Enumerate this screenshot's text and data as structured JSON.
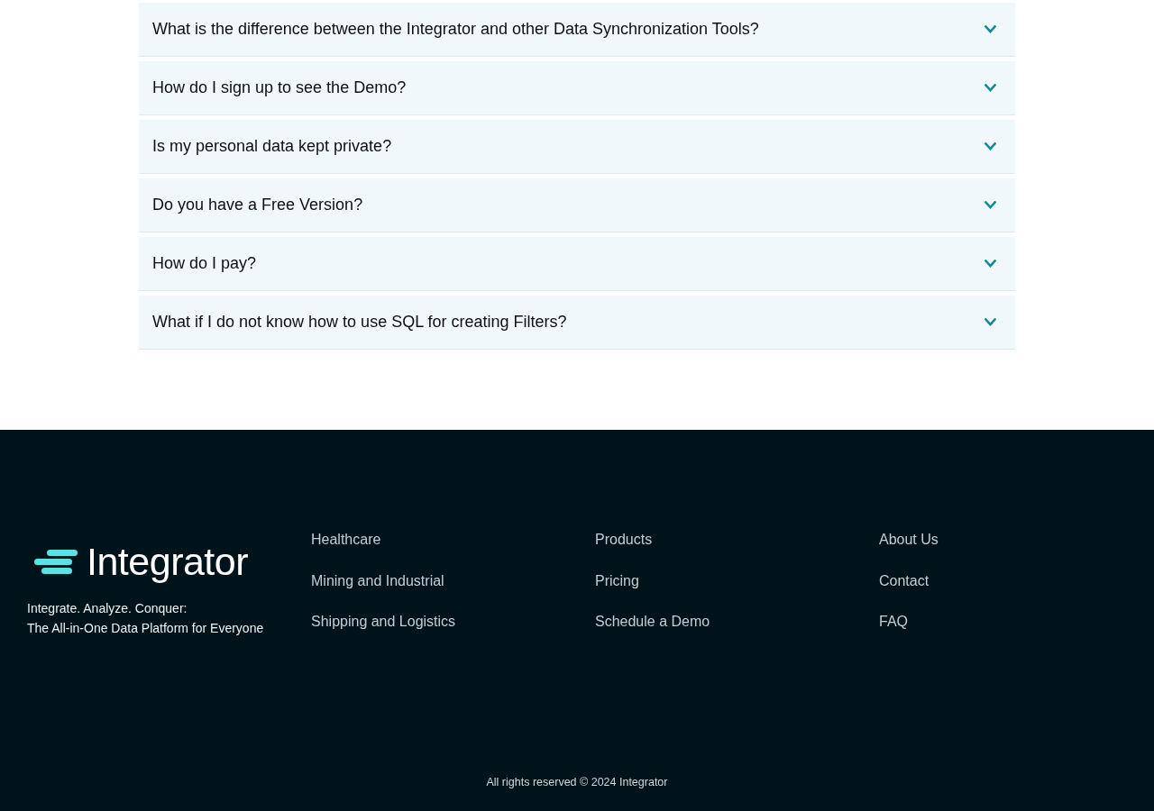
{
  "faq": {
    "items": [
      {
        "question": "What is the difference between the Integrator and other Data Synchronization Tools?",
        "expanded": false
      },
      {
        "question": "How do I sign up to see the Demo?",
        "expanded": false
      },
      {
        "question": "Is my personal data kept private?",
        "expanded": false
      },
      {
        "question": "Do you have a Free Version?",
        "expanded": false
      },
      {
        "question": "How do I pay?",
        "expanded": false
      },
      {
        "question": "What if I do not know how to use SQL for creating Filters?",
        "expanded": false
      }
    ]
  },
  "footer": {
    "logo": {
      "text": "Integrator"
    },
    "tagline": [
      "Integrate. Analyze. Conquer:",
      "The All-in-One Data Platform for Everyone"
    ],
    "columns": [
      {
        "links": [
          "Healthcare",
          "Mining and Industrial",
          "Shipping and Logistics"
        ]
      },
      {
        "links": [
          "Products",
          "Pricing",
          "Schedule a Demo"
        ]
      },
      {
        "links": [
          "About Us",
          "Contact",
          "FAQ"
        ]
      }
    ],
    "copyright": "All rights reserved © 2024 Integrator"
  }
}
